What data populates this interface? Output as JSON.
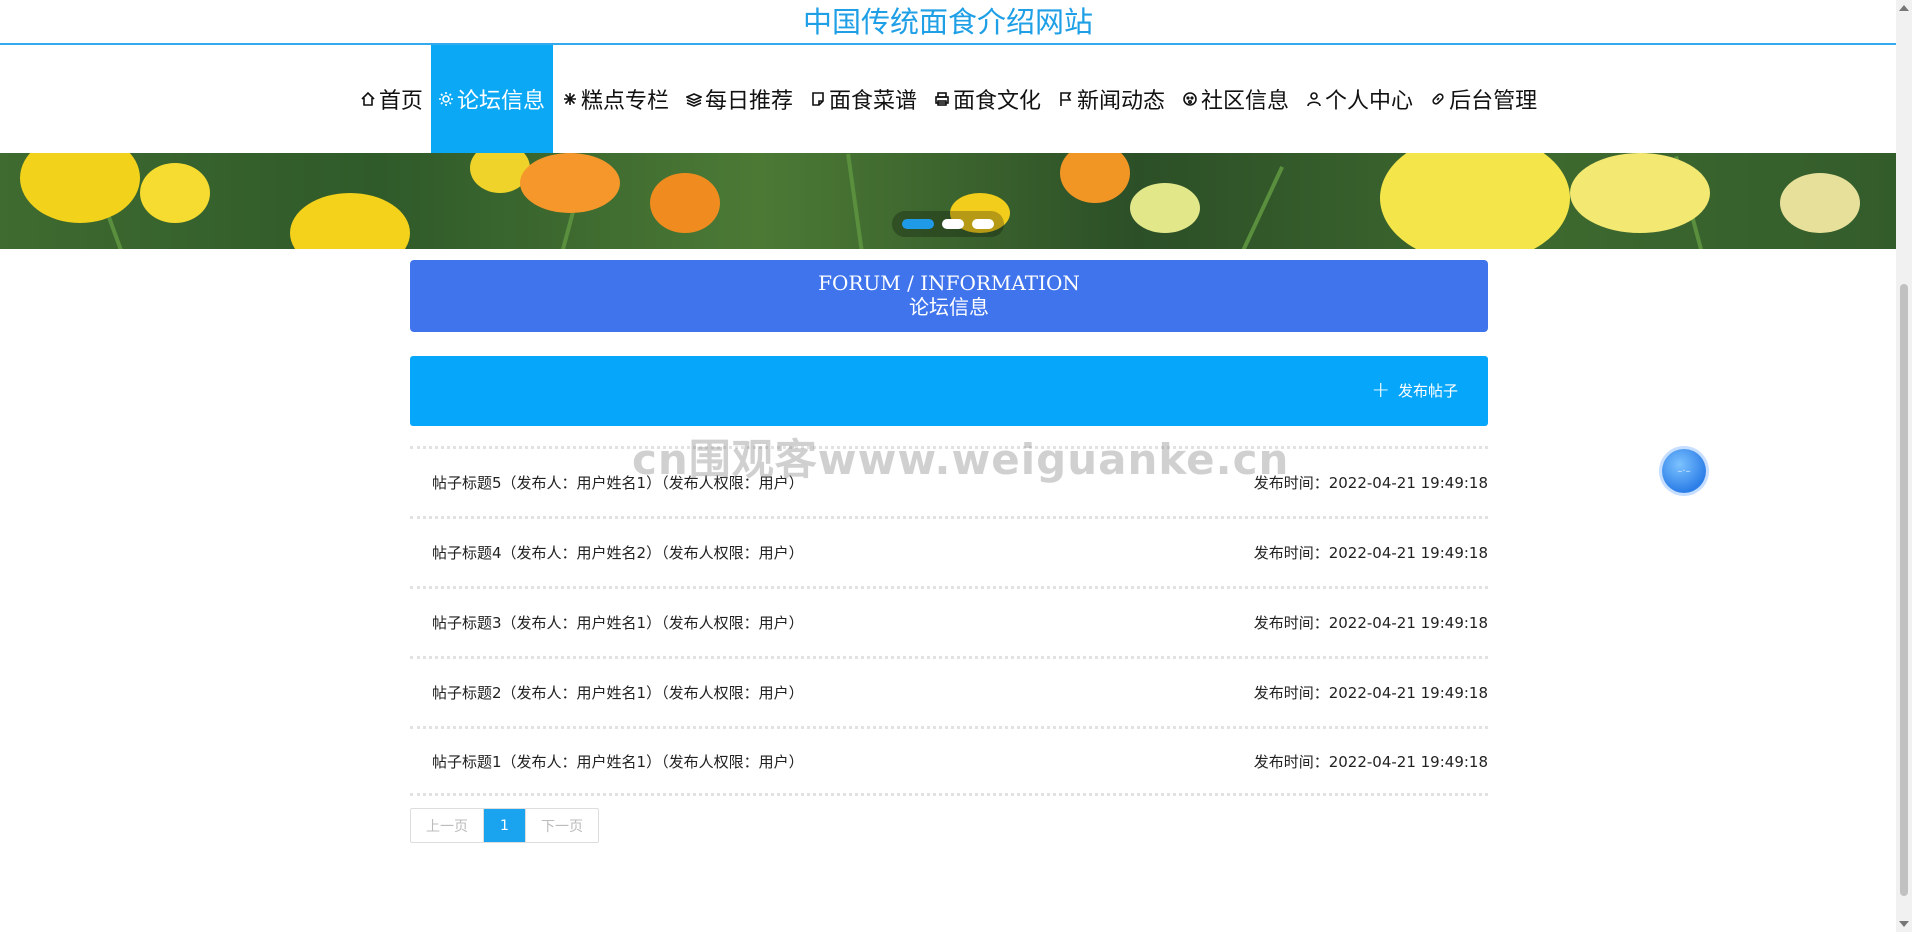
{
  "site": {
    "title": "中国传统面食介绍网站"
  },
  "nav": {
    "items": [
      {
        "label": "首页",
        "icon": "home-icon"
      },
      {
        "label": "论坛信息",
        "icon": "gear-icon",
        "active": true
      },
      {
        "label": "糕点专栏",
        "icon": "snowflake-icon"
      },
      {
        "label": "每日推荐",
        "icon": "layers-icon"
      },
      {
        "label": "面食菜谱",
        "icon": "note-icon"
      },
      {
        "label": "面食文化",
        "icon": "printer-icon"
      },
      {
        "label": "新闻动态",
        "icon": "flag-icon"
      },
      {
        "label": "社区信息",
        "icon": "face-icon"
      },
      {
        "label": "个人中心",
        "icon": "user-icon"
      },
      {
        "label": "后台管理",
        "icon": "link-icon"
      }
    ]
  },
  "banner": {
    "slides": 3,
    "active_slide": 1
  },
  "section": {
    "title_en": "FORUM / INFORMATION",
    "title_cn": "论坛信息"
  },
  "toolbar": {
    "publish_label": "发布帖子"
  },
  "posts": [
    {
      "title": "帖子标题5（发布人：用户姓名1）（发布人权限：用户）",
      "time": "发布时间：2022-04-21 19:49:18"
    },
    {
      "title": "帖子标题4（发布人：用户姓名2）（发布人权限：用户）",
      "time": "发布时间：2022-04-21 19:49:18"
    },
    {
      "title": "帖子标题3（发布人：用户姓名1）（发布人权限：用户）",
      "time": "发布时间：2022-04-21 19:49:18"
    },
    {
      "title": "帖子标题2（发布人：用户姓名1）（发布人权限：用户）",
      "time": "发布时间：2022-04-21 19:49:18"
    },
    {
      "title": "帖子标题1（发布人：用户姓名1）（发布人权限：用户）",
      "time": "发布时间：2022-04-21 19:49:18"
    }
  ],
  "pager": {
    "prev": "上一页",
    "current": "1",
    "next": "下一页"
  },
  "watermark": "cn围观客www.weiguanke.cn",
  "colors": {
    "accent": "#0aa8f5",
    "section_bg": "#3f74ec",
    "title": "#1e9fe6"
  }
}
